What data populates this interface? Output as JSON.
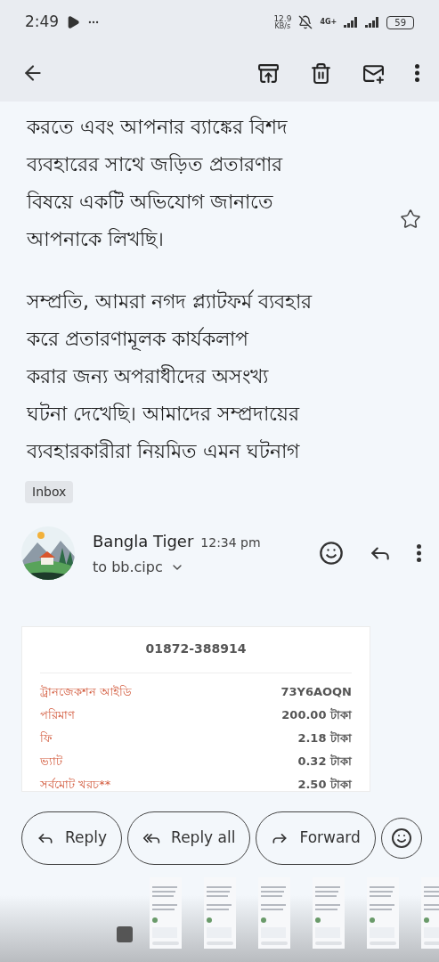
{
  "status_bar": {
    "time": "2:49",
    "speed_value": "12.9",
    "speed_unit": "KB/s",
    "network": "4G+",
    "battery": "59"
  },
  "body": {
    "paragraphs": [
      [
        "করতে এবং আপনার ব্যাঙ্কের বিশদ",
        "ব্যবহারের সাথে জড়িত প্রতারণার",
        "বিষয়ে একটি অভিযোগ জানাতে",
        "আপনাকে লিখছি।"
      ],
      [
        "সম্প্রতি, আমরা নগদ প্ল্যাটফর্ম ব্যবহার",
        "করে প্রতারণামূলক কার্যকলাপ",
        "করার জন্য অপরাধীদের অসংখ্য",
        "ঘটনা দেখেছি। আমাদের সম্প্রদায়ের",
        "ব্যবহারকারীরা নিয়মিত এমন ঘটনাগ"
      ]
    ],
    "starred": false
  },
  "label": "Inbox",
  "message": {
    "sender": "Bangla Tiger",
    "time": "12:34 pm",
    "recipient": "to bb.cipc"
  },
  "receipt": {
    "phone": "01872-388914",
    "rows": [
      {
        "label": "ট্রানজেকশন আইডি",
        "value": "73Y6AOQN"
      },
      {
        "label": "পরিমাণ",
        "value": "200.00 টাকা"
      },
      {
        "label": "ফি",
        "value": "2.18 টাকা"
      },
      {
        "label": "ভ্যাট",
        "value": "0.32 টাকা"
      },
      {
        "label": "সর্বমোট খরচ**",
        "value": "2.50 টাকা"
      }
    ]
  },
  "actions": [
    {
      "kind": "reply",
      "label": "Reply"
    },
    {
      "kind": "reply_all",
      "label": "Reply all"
    },
    {
      "kind": "forward",
      "label": "Forward"
    }
  ]
}
